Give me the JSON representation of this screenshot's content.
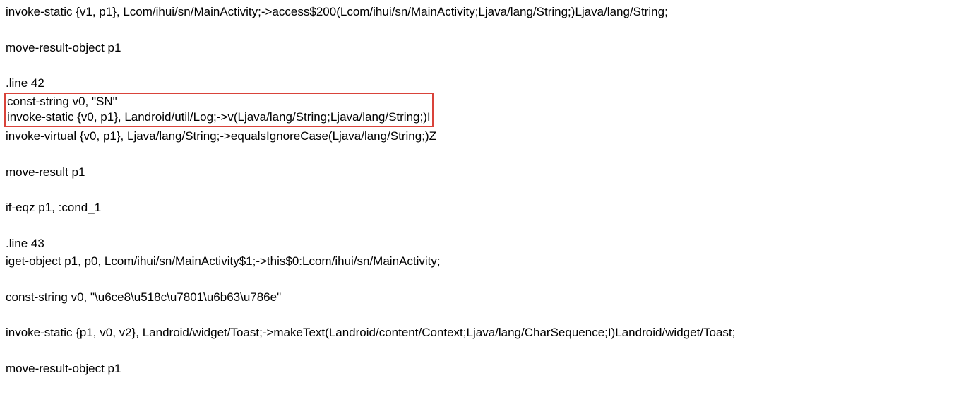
{
  "code": {
    "line1": "invoke-static {v1, p1}, Lcom/ihui/sn/MainActivity;->access$200(Lcom/ihui/sn/MainActivity;Ljava/lang/String;)Ljava/lang/String;",
    "line2": "move-result-object p1",
    "line3": ".line 42",
    "highlighted_line1": "const-string v0, \"SN\"",
    "highlighted_line2": "invoke-static {v0, p1}, Landroid/util/Log;->v(Ljava/lang/String;Ljava/lang/String;)I",
    "line4": "invoke-virtual {v0, p1}, Ljava/lang/String;->equalsIgnoreCase(Ljava/lang/String;)Z",
    "line5": "move-result p1",
    "line6": "if-eqz p1, :cond_1",
    "line7": ".line 43",
    "line8": "iget-object p1, p0, Lcom/ihui/sn/MainActivity$1;->this$0:Lcom/ihui/sn/MainActivity;",
    "line9": "const-string v0, \"\\u6ce8\\u518c\\u7801\\u6b63\\u786e\"",
    "line10": "invoke-static {p1, v0, v2}, Landroid/widget/Toast;->makeText(Landroid/content/Context;Ljava/lang/CharSequence;I)Landroid/widget/Toast;",
    "line11": "move-result-object p1"
  },
  "highlight": {
    "border_color": "#d9433a"
  }
}
